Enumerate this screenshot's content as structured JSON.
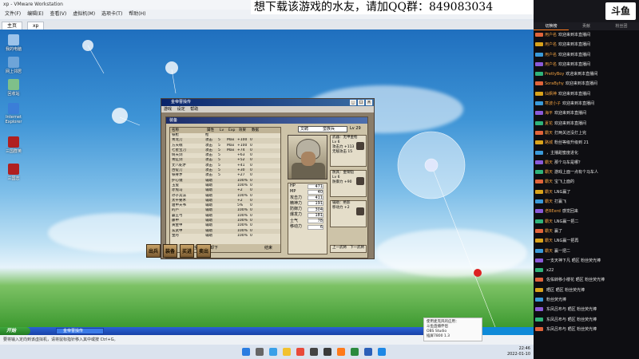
{
  "caption": "想下载该游戏的水友，请加QQ群：849083034",
  "vmware": {
    "title": "xp - VMware Workstation",
    "menu": [
      "文件(F)",
      "编辑(E)",
      "查看(V)",
      "虚拟机(M)",
      "选项卡(T)",
      "帮助(H)"
    ],
    "tabs": [
      "主页",
      "xp"
    ]
  },
  "desktop_icons": [
    "我的电脑",
    "网上邻居",
    "回收站",
    "Internet Explorer",
    "三国群英",
    "三国志"
  ],
  "game": {
    "window_title": "金帝曹操传",
    "menu": [
      "游戏",
      "设定",
      "帮助"
    ],
    "equip_title": "装备",
    "list_title": "全装列表",
    "list_headers": [
      "名称",
      "属性",
      "Lv",
      "Exp",
      "效果",
      "数据"
    ],
    "list_rows": [
      [
        "铁枪",
        "枪",
        "",
        "",
        "",
        ""
      ],
      [
        "青龙刀",
        "攻击",
        "5",
        "Max",
        "+100",
        "0"
      ],
      [
        "方天戟",
        "攻击",
        "5",
        "Max",
        "+100",
        "0"
      ],
      [
        "七星宝刀",
        "攻击",
        "5",
        "Max",
        "+74",
        "0"
      ],
      [
        "倚天剑",
        "攻击",
        "5",
        "",
        "+63",
        "0"
      ],
      [
        "青釭剑",
        "攻击",
        "5",
        "",
        "+52",
        "0"
      ],
      [
        "丈八蛇矛",
        "攻击",
        "5",
        "",
        "+41",
        "0"
      ],
      [
        "古锭刀",
        "攻击",
        "5",
        "",
        "+30",
        "0"
      ],
      [
        "铁脊矛",
        "攻击",
        "5",
        "",
        "+27",
        "0"
      ],
      [
        "护心镜",
        "辅助",
        "",
        "",
        "100%",
        "0"
      ],
      [
        "玉玺",
        "辅助",
        "",
        "",
        "100%",
        "0"
      ],
      [
        "赤兔马",
        "辅助",
        "",
        "",
        "+2",
        "0"
      ],
      [
        "孙子兵法",
        "辅助",
        "",
        "",
        "100%",
        "0"
      ],
      [
        "太平要术",
        "辅助",
        "",
        "",
        "+2",
        "0"
      ],
      [
        "遁甲天书",
        "辅助",
        "",
        "",
        "5%",
        "0"
      ],
      [
        "的卢",
        "辅助",
        "",
        "",
        "100%",
        "0"
      ],
      [
        "霸王弓",
        "辅助",
        "",
        "",
        "100%",
        "0"
      ],
      [
        "藤甲",
        "辅助",
        "",
        "",
        "100%",
        "0"
      ],
      [
        "黄金甲",
        "辅助",
        "",
        "",
        "100%",
        "0"
      ],
      [
        "玄武甲",
        "辅助",
        "",
        "",
        "100%",
        "0"
      ],
      [
        "金丹",
        "辅助",
        "",
        "",
        "100%",
        "0"
      ]
    ],
    "list_footer_left": "全部装备卸下",
    "list_footer_right": "结束",
    "selector": [
      "文聘",
      "蛮族兵"
    ],
    "level": "Lv 29",
    "stats": [
      [
        "HP",
        "471"
      ],
      [
        "MP",
        "40"
      ],
      [
        "攻击力",
        "411"
      ],
      [
        "精神力",
        "191"
      ],
      [
        "防御力",
        "304"
      ],
      [
        "爆发力",
        "181"
      ],
      [
        "士气",
        "78"
      ],
      [
        "移动力",
        "6"
      ]
    ],
    "slots": [
      {
        "label": "武器：无甲金枪",
        "detail": "Lv 6\n攻击力 +113\n无敌攻击 15"
      },
      {
        "label": "防具：金铜铠",
        "detail": "Lv 6\n防御力 +90"
      },
      {
        "label": "辅助：绝影",
        "detail": "移动力 +2"
      }
    ],
    "page_nav": [
      "上一武将",
      "下一武将"
    ],
    "buttons": [
      "出兵",
      "装备",
      "买进",
      "卖出"
    ]
  },
  "xp_taskbar": {
    "start": "开始",
    "item": "金帝曹操传"
  },
  "vm_status": "要将输入定向到该虚拟机，请将鼠标指针移入其中或按 Ctrl+G。",
  "obs_tip": [
    "使用麦克风的应用：",
    "斗鱼直播伴侣",
    "OBS Studio",
    "插屏7800 1.3"
  ],
  "host_clock": [
    "22:46",
    "2022-01-10"
  ],
  "chat": {
    "logo": "斗鱼",
    "tabs": [
      "切换榜",
      "贡献",
      "粉丝团"
    ],
    "messages": [
      {
        "user": "用户名",
        "text": "欢迎来到本直播间"
      },
      {
        "user": "用户名",
        "text": "欢迎来到本直播间"
      },
      {
        "user": "用户名",
        "text": "欢迎来到本直播间"
      },
      {
        "user": "用户名",
        "text": "欢迎来到本直播间"
      },
      {
        "user": "PrettyBoy",
        "text": "欢迎来到本直播间"
      },
      {
        "user": "SoraByhy",
        "text": "欢迎来到本直播间"
      },
      {
        "user": "仙枫神",
        "text": "欢迎来到本直播间"
      },
      {
        "user": "寒波小子",
        "text": "欢迎来到本直播间"
      },
      {
        "user": "海平",
        "text": "欢迎来到本直播间"
      },
      {
        "user": "夏花",
        "text": "欢迎来到本直播间"
      },
      {
        "user": "霸天",
        "text": "打两关还没打上完"
      },
      {
        "user": "路城",
        "text": "粉丝等级升级到 21"
      },
      {
        "user": "",
        "text": "，主播甜蜜度进化"
      },
      {
        "user": "霸天",
        "text": "那个马车是哪？"
      },
      {
        "user": "霸天",
        "text": "游戏上面一点有个马车人"
      },
      {
        "user": "霸天",
        "text": "宝飞上面的"
      },
      {
        "user": "霸天",
        "text": "LNG赢了"
      },
      {
        "user": "霸天",
        "text": "打赢飞"
      },
      {
        "user": "老BEerd",
        "text": "感觉回来"
      },
      {
        "user": "霸天",
        "text": "LNG赢一把二"
      },
      {
        "user": "霸天",
        "text": "赢了"
      },
      {
        "user": "霸天",
        "text": "LNG赢一把再"
      },
      {
        "user": "霸天",
        "text": "赢一把二"
      },
      {
        "user": "",
        "text": "一支天神下凡 晒区 粉丝荧光棒"
      },
      {
        "user": "",
        "text": "x22"
      },
      {
        "user": "",
        "text": "佐佑转移小楼花 晒区 粉丝荧光棒"
      },
      {
        "user": "",
        "text": "晒区 晒区 粉丝荧光棒"
      },
      {
        "user": "",
        "text": "粉丝荧光棒"
      },
      {
        "user": "",
        "text": "东凤吕布与 晒区 粉丝荧光棒"
      },
      {
        "user": "",
        "text": "东凤吕布与 晒区 粉丝荧光棒"
      },
      {
        "user": "",
        "text": "东凤吕布与 晒区 粉丝荧光棒"
      }
    ]
  }
}
